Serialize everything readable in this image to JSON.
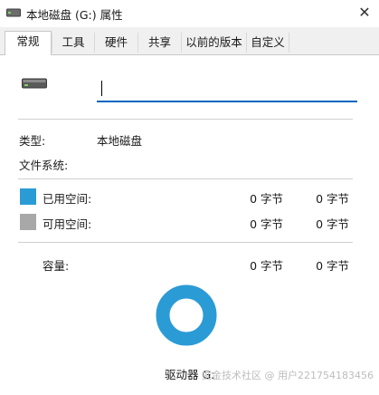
{
  "window": {
    "title": "本地磁盘 (G:) 属性",
    "close_glyph": "✕"
  },
  "tabs": [
    {
      "label": "常规",
      "active": true
    },
    {
      "label": "工具",
      "active": false
    },
    {
      "label": "硬件",
      "active": false
    },
    {
      "label": "共享",
      "active": false
    },
    {
      "label": "以前的版本",
      "active": false
    },
    {
      "label": "自定义",
      "active": false
    }
  ],
  "general": {
    "name_value": "",
    "type_label": "类型:",
    "type_value": "本地磁盘",
    "filesystem_label": "文件系统:",
    "filesystem_value": "",
    "used_label": "已用空间:",
    "used_bytes": "0 字节",
    "used_size": "0 字节",
    "free_label": "可用空间:",
    "free_bytes": "0 字节",
    "free_size": "0 字节",
    "capacity_label": "容量:",
    "capacity_bytes": "0 字节",
    "capacity_size": "0 字节",
    "drive_label": "驱动器 G:"
  },
  "colors": {
    "used": "#2b9bd6",
    "free": "#a8a8a8",
    "accent": "#0067c0",
    "donut": "#2b9bd6"
  },
  "watermark": "掘金技术社区 @ 用户221754183456"
}
